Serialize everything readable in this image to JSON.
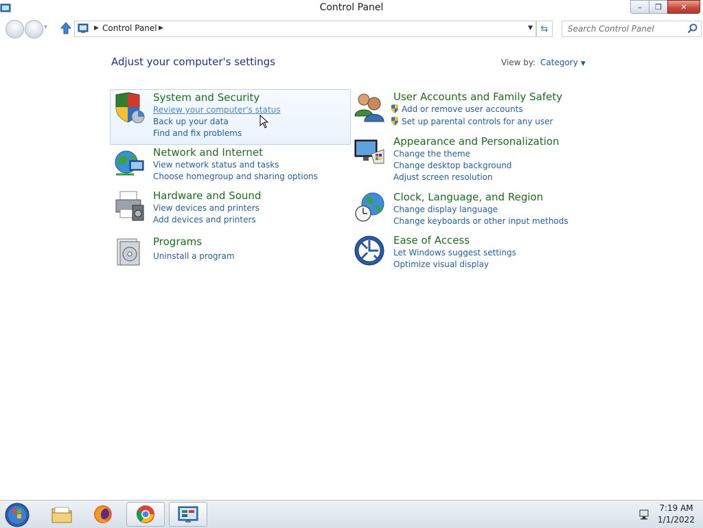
{
  "window": {
    "title": "Control Panel",
    "controls": {
      "minimize": "–",
      "restore": "❐",
      "close": "✕"
    }
  },
  "address_bar": {
    "breadcrumb": "Control Panel",
    "search_placeholder": "Search Control Panel"
  },
  "main": {
    "heading": "Adjust your computer's settings",
    "view_by_label": "View by:",
    "view_by_value": "Category",
    "categories": [
      {
        "title": "System and Security",
        "icon": "shield-icon",
        "links": [
          "Review your computer's status",
          "Back up your data",
          "Find and fix problems"
        ]
      },
      {
        "title": "Network and Internet",
        "icon": "network-icon",
        "links": [
          "View network status and tasks",
          "Choose homegroup and sharing options"
        ]
      },
      {
        "title": "Hardware and Sound",
        "icon": "printer-icon",
        "links": [
          "View devices and printers",
          "Add devices and printers"
        ]
      },
      {
        "title": "Programs",
        "icon": "programs-icon",
        "links": [
          "Uninstall a program"
        ]
      },
      {
        "title": "User Accounts and Family Safety",
        "icon": "users-icon",
        "links": [
          "Add or remove user accounts",
          "Set up parental controls for any user"
        ]
      },
      {
        "title": "Appearance and Personalization",
        "icon": "display-icon",
        "links": [
          "Change the theme",
          "Change desktop background",
          "Adjust screen resolution"
        ]
      },
      {
        "title": "Clock, Language, and Region",
        "icon": "clock-globe-icon",
        "links": [
          "Change display language",
          "Change keyboards or other input methods"
        ]
      },
      {
        "title": "Ease of Access",
        "icon": "ease-of-access-icon",
        "links": [
          "Let Windows suggest settings",
          "Optimize visual display"
        ]
      }
    ]
  },
  "taskbar": {
    "items": [
      "start-orb",
      "file-explorer",
      "firefox",
      "chrome",
      "control-panel"
    ],
    "clock_time": "7:19 AM",
    "clock_date": "1/1/2022"
  },
  "colors": {
    "category_title": "#1a6e1a",
    "link": "#1f5fa6",
    "heading": "#1e3287"
  }
}
